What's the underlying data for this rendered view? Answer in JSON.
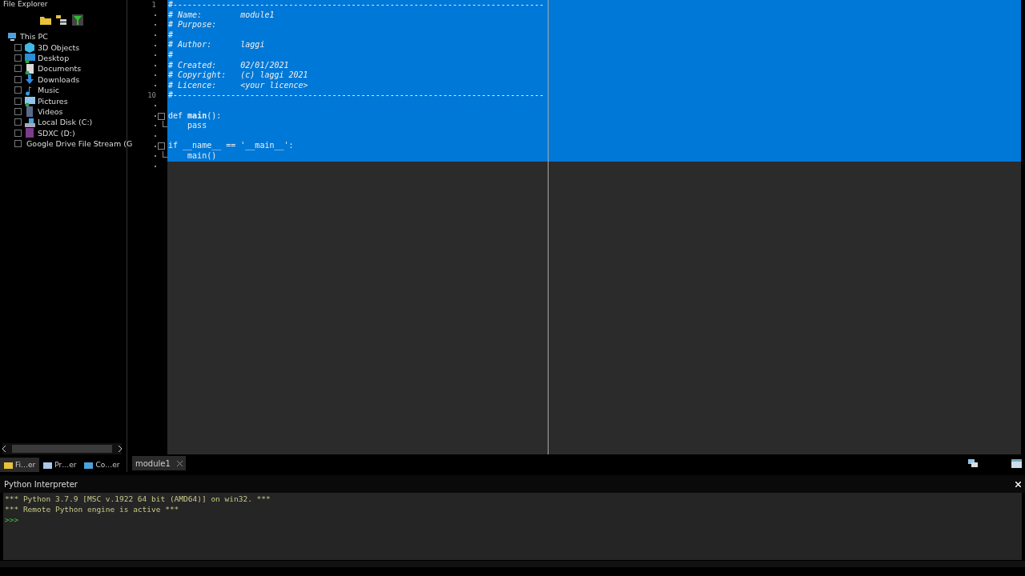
{
  "explorer": {
    "title": "File Explorer",
    "tree": [
      {
        "label": "This PC",
        "kind": "pc",
        "children": [
          {
            "label": "3D Objects",
            "kind": "cube"
          },
          {
            "label": "Desktop",
            "kind": "desktop"
          },
          {
            "label": "Documents",
            "kind": "doc"
          },
          {
            "label": "Downloads",
            "kind": "download"
          },
          {
            "label": "Music",
            "kind": "music"
          },
          {
            "label": "Pictures",
            "kind": "pictures"
          },
          {
            "label": "Videos",
            "kind": "video"
          },
          {
            "label": "Local Disk (C:)",
            "kind": "disk"
          },
          {
            "label": "SDXC (D:)",
            "kind": "sd"
          },
          {
            "label": "Google Drive File Stream (G",
            "kind": "drive"
          }
        ]
      }
    ],
    "tabs": [
      {
        "label": "Fi…er",
        "selected": true
      },
      {
        "label": "Pr…er",
        "selected": false
      },
      {
        "label": "Co…er",
        "selected": false
      }
    ]
  },
  "editor": {
    "tabs": [
      {
        "label": "module1",
        "selected": true
      }
    ],
    "lines": [
      {
        "number": "1",
        "text": "#-----------------------------------------------------------------------------",
        "kind": "comment",
        "selected": true
      },
      {
        "text": "# Name:        module1",
        "kind": "comment",
        "selected": true
      },
      {
        "text": "# Purpose:",
        "kind": "comment",
        "selected": true
      },
      {
        "text": "#",
        "kind": "comment",
        "selected": true
      },
      {
        "text": "# Author:      laggi",
        "kind": "comment",
        "selected": true
      },
      {
        "text": "#",
        "kind": "comment",
        "selected": true
      },
      {
        "text": "# Created:     02/01/2021",
        "kind": "comment",
        "selected": true
      },
      {
        "text": "# Copyright:   (c) laggi 2021",
        "kind": "comment",
        "selected": true
      },
      {
        "text": "# Licence:     <your licence>",
        "kind": "comment",
        "selected": true
      },
      {
        "number": "10",
        "text": "#-----------------------------------------------------------------------------",
        "kind": "comment",
        "selected": true
      },
      {
        "kind": "blank",
        "selected": true
      },
      {
        "text": "def **main**():",
        "kind": "code",
        "fold_start": true,
        "selected": true
      },
      {
        "text": "    pass",
        "kind": "code",
        "fold_end": true,
        "selected": true
      },
      {
        "kind": "blank",
        "selected": true
      },
      {
        "text": "if __name__ == '__main__':",
        "kind": "code",
        "fold_start": true,
        "selected": true
      },
      {
        "text": "    main()",
        "kind": "code",
        "fold_end": true,
        "selected": true
      },
      {
        "kind": "blank",
        "selected": false
      }
    ]
  },
  "interpreter": {
    "title": "Python Interpreter",
    "output": [
      {
        "text": "*** Python 3.7.9 [MSC v.1922 64 bit (AMD64)] on win32. ***",
        "kind": "info"
      },
      {
        "text": "*** Remote Python engine is active ***",
        "kind": "info"
      },
      {
        "text": ">>>",
        "kind": "prompt"
      }
    ]
  }
}
